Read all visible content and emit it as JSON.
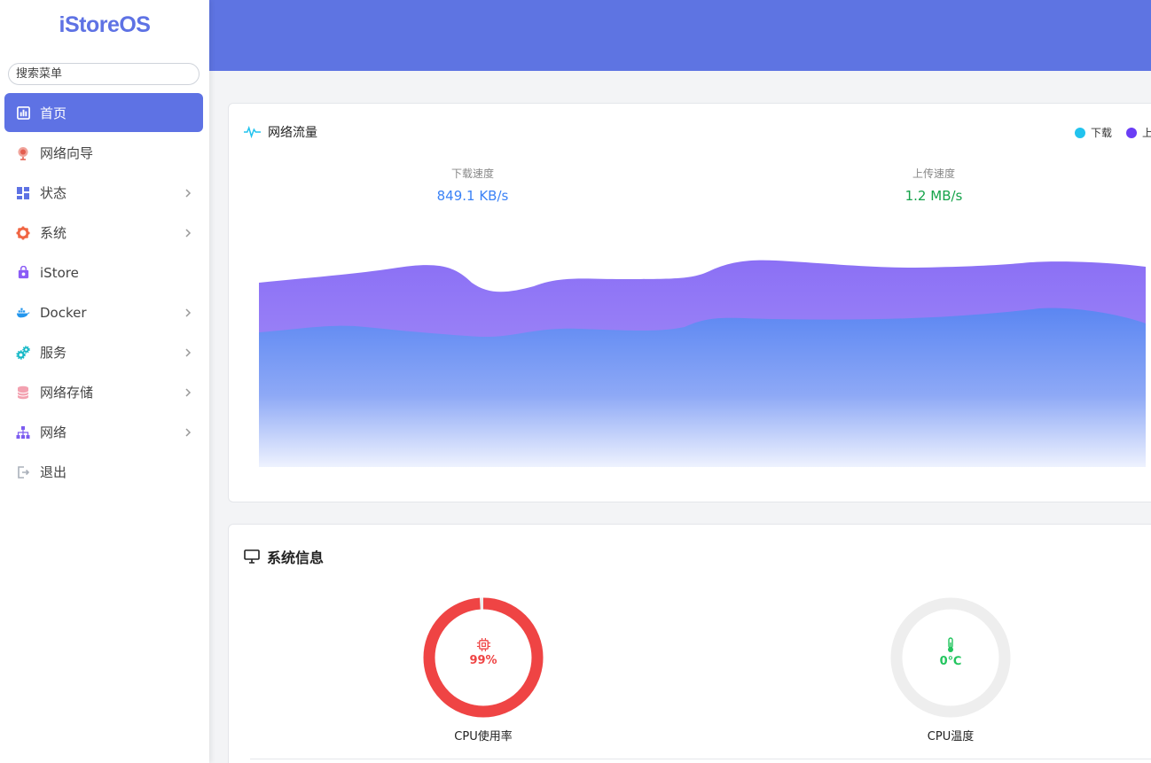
{
  "brand": {
    "logo": "iStoreOS",
    "accent": "#5e72e4"
  },
  "sidebar": {
    "search_placeholder": "搜索菜单",
    "items": [
      {
        "label": "首页",
        "icon": "dashboard-icon",
        "active": true,
        "has_submenu": false
      },
      {
        "label": "网络向导",
        "icon": "globe-pin-icon",
        "active": false,
        "has_submenu": false
      },
      {
        "label": "状态",
        "icon": "grid-status-icon",
        "active": false,
        "has_submenu": true
      },
      {
        "label": "系统",
        "icon": "gear-icon",
        "active": false,
        "has_submenu": true
      },
      {
        "label": "iStore",
        "icon": "bag-icon",
        "active": false,
        "has_submenu": false
      },
      {
        "label": "Docker",
        "icon": "docker-icon",
        "active": false,
        "has_submenu": true
      },
      {
        "label": "服务",
        "icon": "cogs-icon",
        "active": false,
        "has_submenu": true
      },
      {
        "label": "网络存储",
        "icon": "database-icon",
        "active": false,
        "has_submenu": true
      },
      {
        "label": "网络",
        "icon": "network-tree-icon",
        "active": false,
        "has_submenu": true
      },
      {
        "label": "退出",
        "icon": "logout-icon",
        "active": false,
        "has_submenu": false
      }
    ]
  },
  "traffic": {
    "title": "网络流量",
    "legend": {
      "download": "下载",
      "upload": "上"
    },
    "download_label": "下载速度",
    "download_value": "849.1 KB/s",
    "upload_label": "上传速度",
    "upload_value": "1.2 MB/s",
    "colors": {
      "download": "#22c3ee",
      "upload": "#6a3df5",
      "download_value": "#3b82f6",
      "upload_value": "#16a34a"
    }
  },
  "system_info": {
    "title": "系统信息",
    "cpu": {
      "label": "CPU使用率",
      "value": "99%",
      "fraction": 0.99,
      "color": "#ef4444"
    },
    "temp": {
      "label": "CPU温度",
      "value": "0℃",
      "fraction": 0.0,
      "color": "#22c55e"
    }
  }
}
